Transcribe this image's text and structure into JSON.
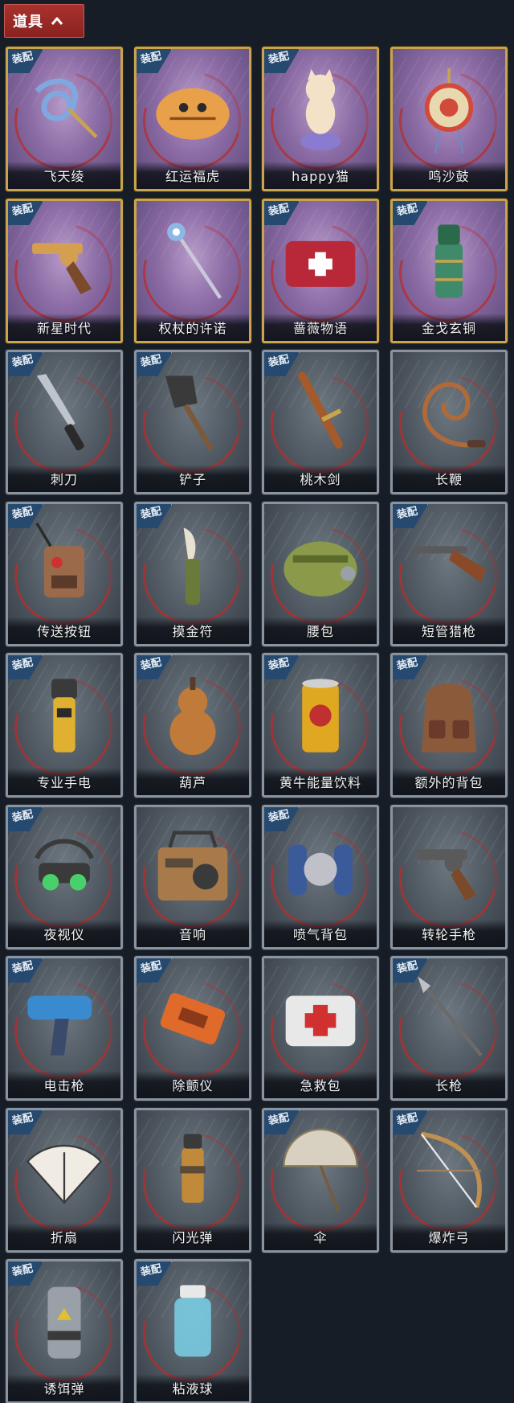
{
  "header": {
    "title": "道具",
    "expanded": true
  },
  "equip_label": "装配",
  "items": [
    {
      "name": "飞天绫",
      "equipped": true,
      "rarity": "gold",
      "icon": "flying-silk-ribbon-icon",
      "accent": "#7fa8e0"
    },
    {
      "name": "红运福虎",
      "equipped": true,
      "rarity": "gold",
      "icon": "lucky-tiger-pillow-icon",
      "accent": "#e8a14a"
    },
    {
      "name": "happy猫",
      "equipped": true,
      "rarity": "gold",
      "icon": "happy-cat-figurine-icon",
      "accent": "#f3e2c8"
    },
    {
      "name": "鸣沙鼓",
      "equipped": false,
      "rarity": "gold",
      "icon": "rattle-drum-icon",
      "accent": "#d24a3a"
    },
    {
      "name": "新星时代",
      "equipped": true,
      "rarity": "gold",
      "icon": "revolver-gold-icon",
      "accent": "#d4a050"
    },
    {
      "name": "权杖的许诺",
      "equipped": false,
      "rarity": "gold",
      "icon": "scepter-icon",
      "accent": "#8fb7e6"
    },
    {
      "name": "蔷薇物语",
      "equipped": true,
      "rarity": "gold",
      "icon": "rose-medkit-icon",
      "accent": "#b82838"
    },
    {
      "name": "金戈玄铜",
      "equipped": true,
      "rarity": "gold",
      "icon": "bronze-grenade-icon",
      "accent": "#3f8a6a"
    },
    {
      "name": "刺刀",
      "equipped": true,
      "rarity": "silver",
      "icon": "bayonet-icon",
      "accent": "#bfc5cc"
    },
    {
      "name": "铲子",
      "equipped": true,
      "rarity": "silver",
      "icon": "shovel-icon",
      "accent": "#3a3a3a"
    },
    {
      "name": "桃木剑",
      "equipped": true,
      "rarity": "silver",
      "icon": "peachwood-sword-icon",
      "accent": "#a45a2a"
    },
    {
      "name": "长鞭",
      "equipped": false,
      "rarity": "silver",
      "icon": "whip-icon",
      "accent": "#b06a3a"
    },
    {
      "name": "传送按钮",
      "equipped": true,
      "rarity": "silver",
      "icon": "teleport-remote-icon",
      "accent": "#9a6a4a"
    },
    {
      "name": "摸金符",
      "equipped": true,
      "rarity": "silver",
      "icon": "tomb-charm-knife-icon",
      "accent": "#6a7a3a"
    },
    {
      "name": "腰包",
      "equipped": false,
      "rarity": "silver",
      "icon": "waist-bag-icon",
      "accent": "#8a9a4a"
    },
    {
      "name": "短管猎枪",
      "equipped": true,
      "rarity": "silver",
      "icon": "sawed-off-shotgun-icon",
      "accent": "#8a4a2a"
    },
    {
      "name": "专业手电",
      "equipped": true,
      "rarity": "silver",
      "icon": "flashlight-icon",
      "accent": "#e0b030"
    },
    {
      "name": "葫芦",
      "equipped": true,
      "rarity": "silver",
      "icon": "gourd-icon",
      "accent": "#c07a3a"
    },
    {
      "name": "黄牛能量饮料",
      "equipped": true,
      "rarity": "silver",
      "icon": "energy-drink-can-icon",
      "accent": "#e0a820"
    },
    {
      "name": "额外的背包",
      "equipped": true,
      "rarity": "silver",
      "icon": "extra-backpack-icon",
      "accent": "#8a5a3a"
    },
    {
      "name": "夜视仪",
      "equipped": true,
      "rarity": "silver",
      "icon": "night-vision-goggles-icon",
      "accent": "#4ad06a"
    },
    {
      "name": "音响",
      "equipped": false,
      "rarity": "silver",
      "icon": "boombox-icon",
      "accent": "#a87a4a"
    },
    {
      "name": "喷气背包",
      "equipped": true,
      "rarity": "silver",
      "icon": "jetpack-icon",
      "accent": "#3a5a9a"
    },
    {
      "name": "转轮手枪",
      "equipped": false,
      "rarity": "silver",
      "icon": "revolver-icon",
      "accent": "#5a5a5a"
    },
    {
      "name": "电击枪",
      "equipped": true,
      "rarity": "silver",
      "icon": "stun-gun-icon",
      "accent": "#3a8ad0"
    },
    {
      "name": "除颤仪",
      "equipped": true,
      "rarity": "silver",
      "icon": "defibrillator-icon",
      "accent": "#e06a2a"
    },
    {
      "name": "急救包",
      "equipped": false,
      "rarity": "silver",
      "icon": "first-aid-kit-icon",
      "accent": "#e8e8e8"
    },
    {
      "name": "长枪",
      "equipped": true,
      "rarity": "silver",
      "icon": "spear-icon",
      "accent": "#6a6a6a"
    },
    {
      "name": "折扇",
      "equipped": true,
      "rarity": "silver",
      "icon": "folding-fan-icon",
      "accent": "#f0ece4"
    },
    {
      "name": "闪光弹",
      "equipped": false,
      "rarity": "silver",
      "icon": "flash-grenade-icon",
      "accent": "#c08a3a"
    },
    {
      "name": "伞",
      "equipped": true,
      "rarity": "silver",
      "icon": "umbrella-icon",
      "accent": "#d8d0c0"
    },
    {
      "name": "爆炸弓",
      "equipped": true,
      "rarity": "silver",
      "icon": "explosive-bow-icon",
      "accent": "#c09050"
    },
    {
      "name": "诱饵弹",
      "equipped": true,
      "rarity": "silver",
      "icon": "decoy-canister-icon",
      "accent": "#9aa0a8"
    },
    {
      "name": "粘液球",
      "equipped": true,
      "rarity": "silver",
      "icon": "slime-capsule-icon",
      "accent": "#7ad0e8"
    }
  ]
}
